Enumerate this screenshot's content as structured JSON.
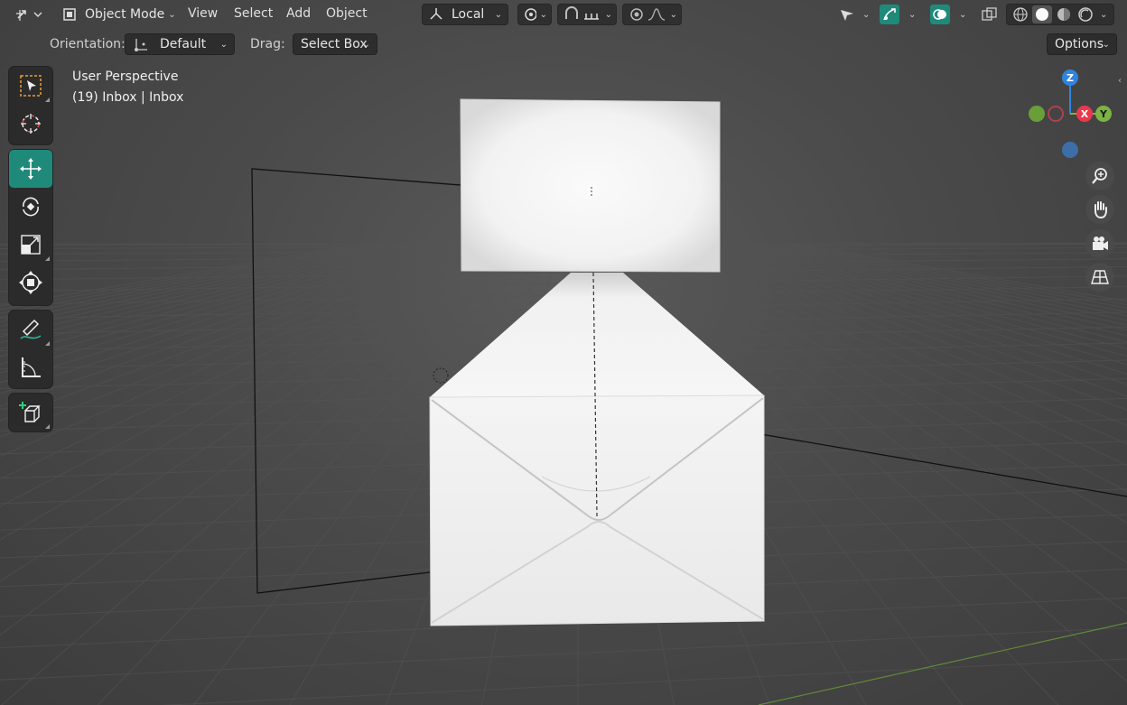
{
  "header": {
    "mode_label": "Object Mode",
    "menus": [
      "View",
      "Select",
      "Add",
      "Object"
    ],
    "transform_orientation": "Local",
    "accent_color": "#1f8a7a"
  },
  "tool_settings": {
    "orientation_label": "Orientation:",
    "orientation_value": "Default",
    "drag_label": "Drag:",
    "drag_value": "Select Box",
    "options_label": "Options"
  },
  "viewport": {
    "view_name": "User Perspective",
    "object_info": "(19) Inbox | Inbox"
  },
  "gizmo": {
    "z_label": "Z",
    "x_label": "X",
    "y_label": "Y",
    "x_color": "#e8394d",
    "y_color": "#7cb342",
    "z_color": "#2f84e0"
  },
  "toolbar": {
    "tools": [
      "select-box-icon",
      "cursor-icon",
      "move-icon",
      "rotate-icon",
      "scale-icon",
      "transform-icon",
      "annotate-icon",
      "measure-icon",
      "add-cube-icon"
    ]
  }
}
